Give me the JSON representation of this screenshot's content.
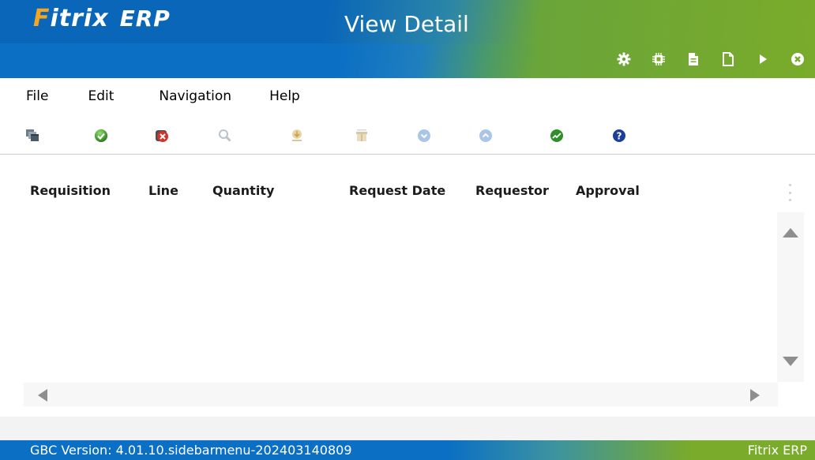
{
  "header": {
    "logo_prefix": "F",
    "logo_name": "itrix",
    "logo_suffix": "ERP",
    "title": "View Detail",
    "icons": [
      "gear-icon",
      "chip-icon",
      "document-icon",
      "new-document-icon",
      "play-icon",
      "close-circle-icon"
    ]
  },
  "menu": {
    "items": [
      "File",
      "Edit",
      "Navigation",
      "Help"
    ]
  },
  "toolbar": {
    "icons": [
      "windows-icon",
      "accept-icon",
      "cancel-icon",
      "search-icon",
      "download-icon",
      "gift-icon",
      "arrow-down-circle-icon",
      "arrow-up-circle-icon",
      "chart-icon",
      "help-icon"
    ]
  },
  "table": {
    "columns": [
      "Requisition",
      "Line",
      "Quantity",
      "Request Date",
      "Requestor",
      "Approval"
    ],
    "rows": []
  },
  "footer": {
    "version": "GBC Version: 4.01.10.sidebarmenu-202403140809",
    "brand": "Fitrix ERP"
  },
  "colors": {
    "header_blue": "#0b6fc4",
    "header_green": "#7aab2a",
    "logo_orange": "#f4a623"
  }
}
